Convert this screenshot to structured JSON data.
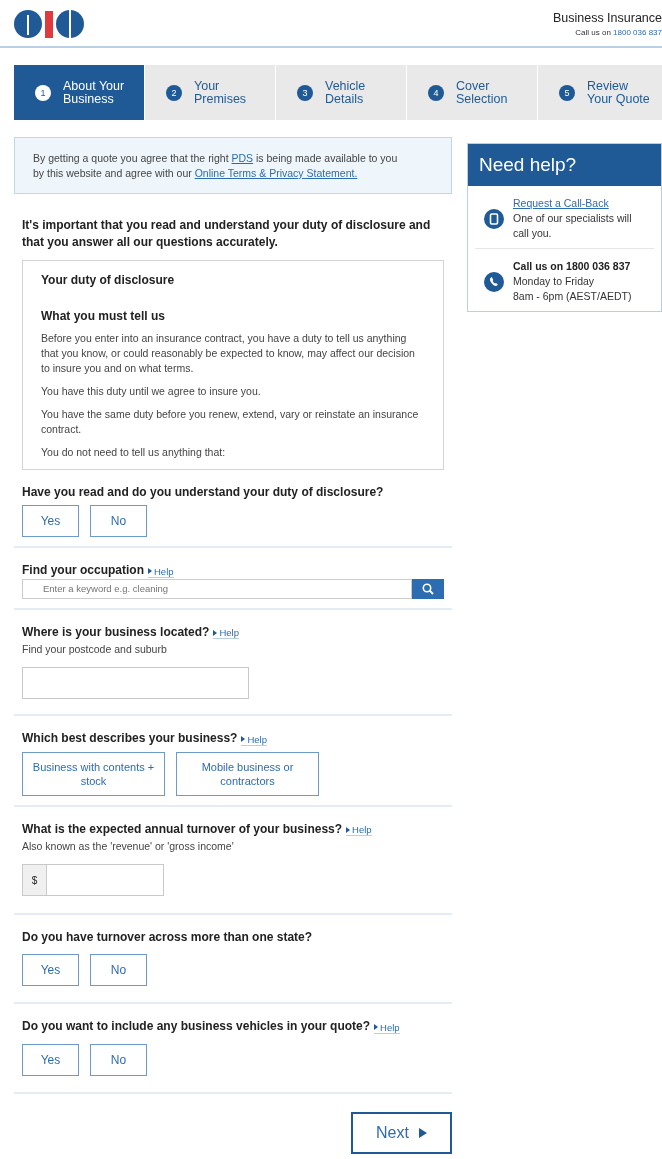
{
  "header": {
    "title": "Business Insurance",
    "call_label": "Call us on",
    "phone": "1800 036 837"
  },
  "steps": [
    {
      "number": "1",
      "label": "About Your Business",
      "selected": true
    },
    {
      "number": "2",
      "label": "Your Premises",
      "selected": false
    },
    {
      "number": "3",
      "label": "Vehicle Details",
      "selected": false
    },
    {
      "number": "4",
      "label": "Cover Selection",
      "selected": false
    },
    {
      "number": "5",
      "label": "Review Your Quote",
      "selected": false
    }
  ],
  "notice": [
    {
      "kind": "text",
      "text": "By getting a quote you agree that the right "
    },
    {
      "kind": "link",
      "text": "PDS"
    },
    {
      "kind": "text",
      "text": " is being made available to you by this website and agree with our "
    },
    {
      "kind": "link",
      "text": "Online Terms & Privacy Statement."
    }
  ],
  "intro": "It's important that you read and understand your duty of disclosure and that you answer all our questions accurately.",
  "disclosure": {
    "title": "Your duty of disclosure",
    "subtitle": "What you must tell us",
    "paragraphs": [
      "Before you enter into an insurance contract, you have a duty to tell us anything that you know, or could reasonably be expected to know, may affect our decision to insure you and on what terms.",
      "You have this duty until we agree to insure you.",
      "You have the same duty before you renew, extend, vary or reinstate an insurance contract.",
      "You do not need to tell us anything that:"
    ]
  },
  "questions": [
    {
      "kind": "choice",
      "title": "Have you read and do you understand your duty of disclosure?",
      "options": [
        {
          "label": "Yes",
          "selected": false
        },
        {
          "label": "No",
          "selected": false
        }
      ]
    },
    {
      "kind": "search",
      "title": "Find your occupation",
      "help": "Help",
      "placeholder": "Enter a keyword e.g. cleaning"
    },
    {
      "kind": "text",
      "title": "Where is your business located?",
      "help": "Help",
      "hint": "Find your postcode and suburb"
    },
    {
      "kind": "wide-choice",
      "title": "Which best describes your business?",
      "help": "Help",
      "options": [
        {
          "label": "Business with contents + stock",
          "selected": false
        },
        {
          "label": "Mobile business or contractors",
          "selected": false
        }
      ]
    },
    {
      "kind": "money",
      "title": "What is the expected annual turnover of your business?",
      "help": "Help",
      "hint": "Also known as the 'revenue' or 'gross income'",
      "prefix": "$"
    },
    {
      "kind": "choice",
      "title": "Do you have turnover across more than one state?",
      "options": [
        {
          "label": "Yes",
          "selected": false
        },
        {
          "label": "No",
          "selected": false
        }
      ]
    },
    {
      "kind": "choice",
      "title": "Do you want to include any business vehicles in your quote?",
      "help": "Help",
      "options": [
        {
          "label": "Yes",
          "selected": false
        },
        {
          "label": "No",
          "selected": false
        }
      ]
    }
  ],
  "next_button": "Next",
  "help_panel": {
    "title": "Need help?",
    "callback_link": "Request a Call-Back",
    "callback_text": "One of our specialists will call you.",
    "call_title": "Call us on 1800 036 837",
    "call_hours": [
      "Monday to Friday",
      "8am - 6pm (AEST/AEDT)"
    ]
  }
}
